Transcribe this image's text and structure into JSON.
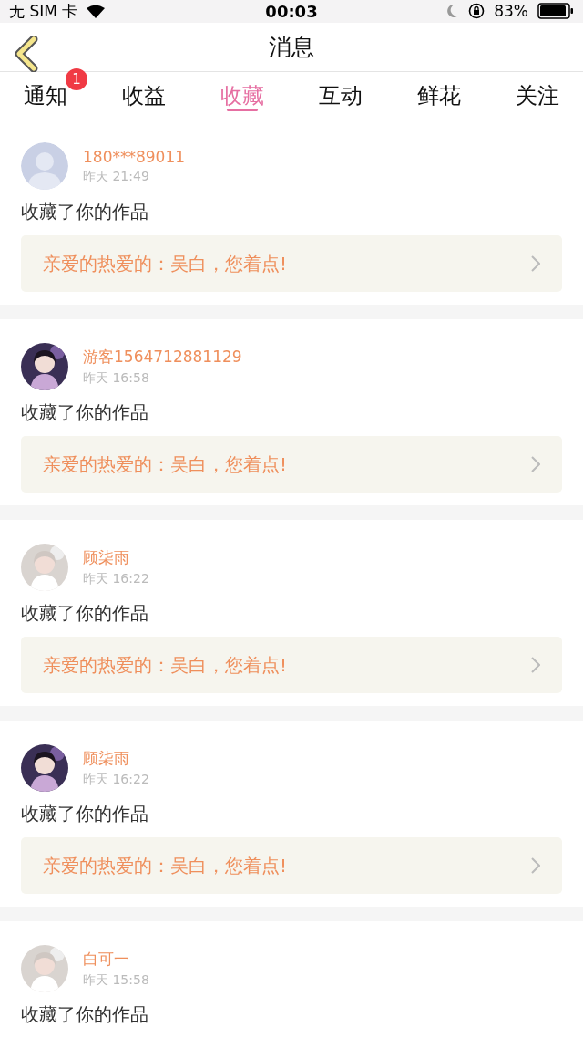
{
  "status_bar": {
    "carrier": "无 SIM 卡",
    "time": "00:03",
    "battery": "83%"
  },
  "nav": {
    "title": "消息"
  },
  "tabs": [
    {
      "label": "通知",
      "selected": false,
      "badge": "1"
    },
    {
      "label": "收益",
      "selected": false
    },
    {
      "label": "收藏",
      "selected": true
    },
    {
      "label": "互动",
      "selected": false
    },
    {
      "label": "鲜花",
      "selected": false
    },
    {
      "label": "关注",
      "selected": false
    }
  ],
  "messages": [
    {
      "avatar": {
        "kind": "placeholder"
      },
      "name": "180***89011",
      "time": "昨天 21:49",
      "action": "收藏了你的作品",
      "work": "亲爱的热爱的：吴白，您着点!"
    },
    {
      "name": "游客1564712881129",
      "time": "昨天 16:58",
      "action": "收藏了你的作品",
      "work": "亲爱的热爱的：吴白，您着点!"
    },
    {
      "name": "顾柒雨",
      "time": "昨天 16:22",
      "action": "收藏了你的作品",
      "work": "亲爱的热爱的：吴白，您着点!"
    },
    {
      "name": "顾柒雨",
      "time": "昨天 16:22",
      "action": "收藏了你的作品",
      "work": "亲爱的热爱的：吴白，您着点!"
    },
    {
      "name": "白可一",
      "time": "昨天 15:58",
      "action": "收藏了你的作品"
    }
  ]
}
